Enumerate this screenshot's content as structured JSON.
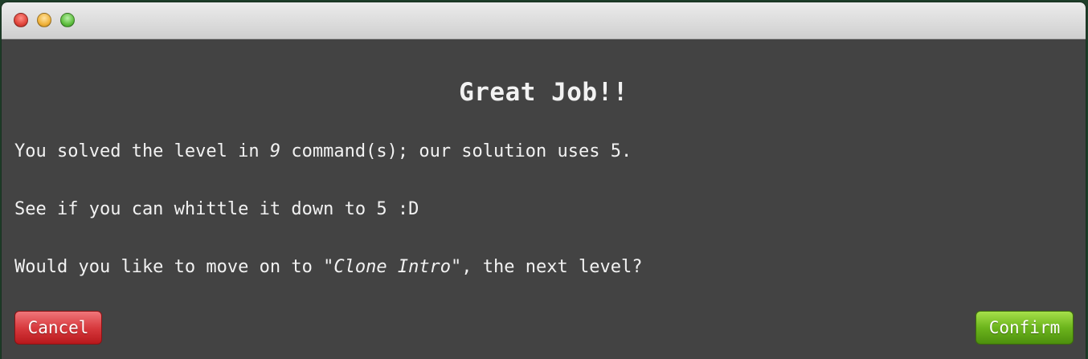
{
  "dialog": {
    "heading": "Great Job!!",
    "line1": {
      "before": "You solved the level in ",
      "count": "9",
      "after": " command(s); our solution uses 5."
    },
    "line2": "See if you can whittle it down to 5 :D",
    "line3": {
      "before": "Would you like to move on to ",
      "level_name": "\"Clone Intro\"",
      "after": ", the next level?"
    },
    "cancel_label": "Cancel",
    "confirm_label": "Confirm"
  },
  "colors": {
    "background": "#434343",
    "text": "#f2f2f2",
    "cancel": "#d83b3f",
    "confirm": "#6cb51c"
  }
}
